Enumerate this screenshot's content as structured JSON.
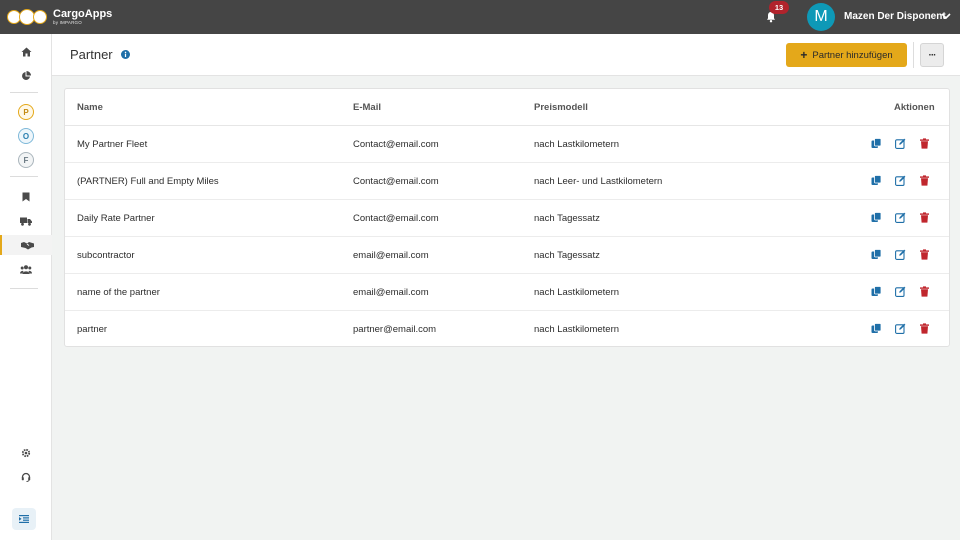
{
  "topbar": {
    "app_title": "CargoApps",
    "app_subtitle": "by IMPARGO",
    "notification_count": "13",
    "avatar_letter": "M",
    "user_name": "Mazen Der Disponent"
  },
  "sidebar": {
    "letters": [
      "P",
      "O",
      "F"
    ]
  },
  "header": {
    "title": "Partner",
    "add_button_label": "Partner hinzufügen",
    "more_button_label": "···"
  },
  "table": {
    "columns": {
      "name": "Name",
      "email": "E-Mail",
      "price_model": "Preismodell",
      "actions": "Aktionen"
    },
    "rows": [
      {
        "name": "My Partner Fleet",
        "email": "Contact@email.com",
        "price_model": "nach Lastkilometern"
      },
      {
        "name": "(PARTNER) Full and Empty Miles",
        "email": "Contact@email.com",
        "price_model": "nach Leer- und Lastkilometern"
      },
      {
        "name": "Daily Rate Partner",
        "email": "Contact@email.com",
        "price_model": "nach Tagessatz"
      },
      {
        "name": "subcontractor",
        "email": "email@email.com",
        "price_model": "nach Tagessatz"
      },
      {
        "name": "name of the partner",
        "email": "email@email.com",
        "price_model": "nach Lastkilometern"
      },
      {
        "name": "partner",
        "email": "partner@email.com",
        "price_model": "nach Lastkilometern"
      }
    ]
  },
  "colors": {
    "accent": "#e4a81a",
    "topbar": "#454545",
    "badge": "#b1232c",
    "avatar": "#0e99b7",
    "action_blue": "#1f6fa8",
    "delete_red": "#c0262d"
  }
}
